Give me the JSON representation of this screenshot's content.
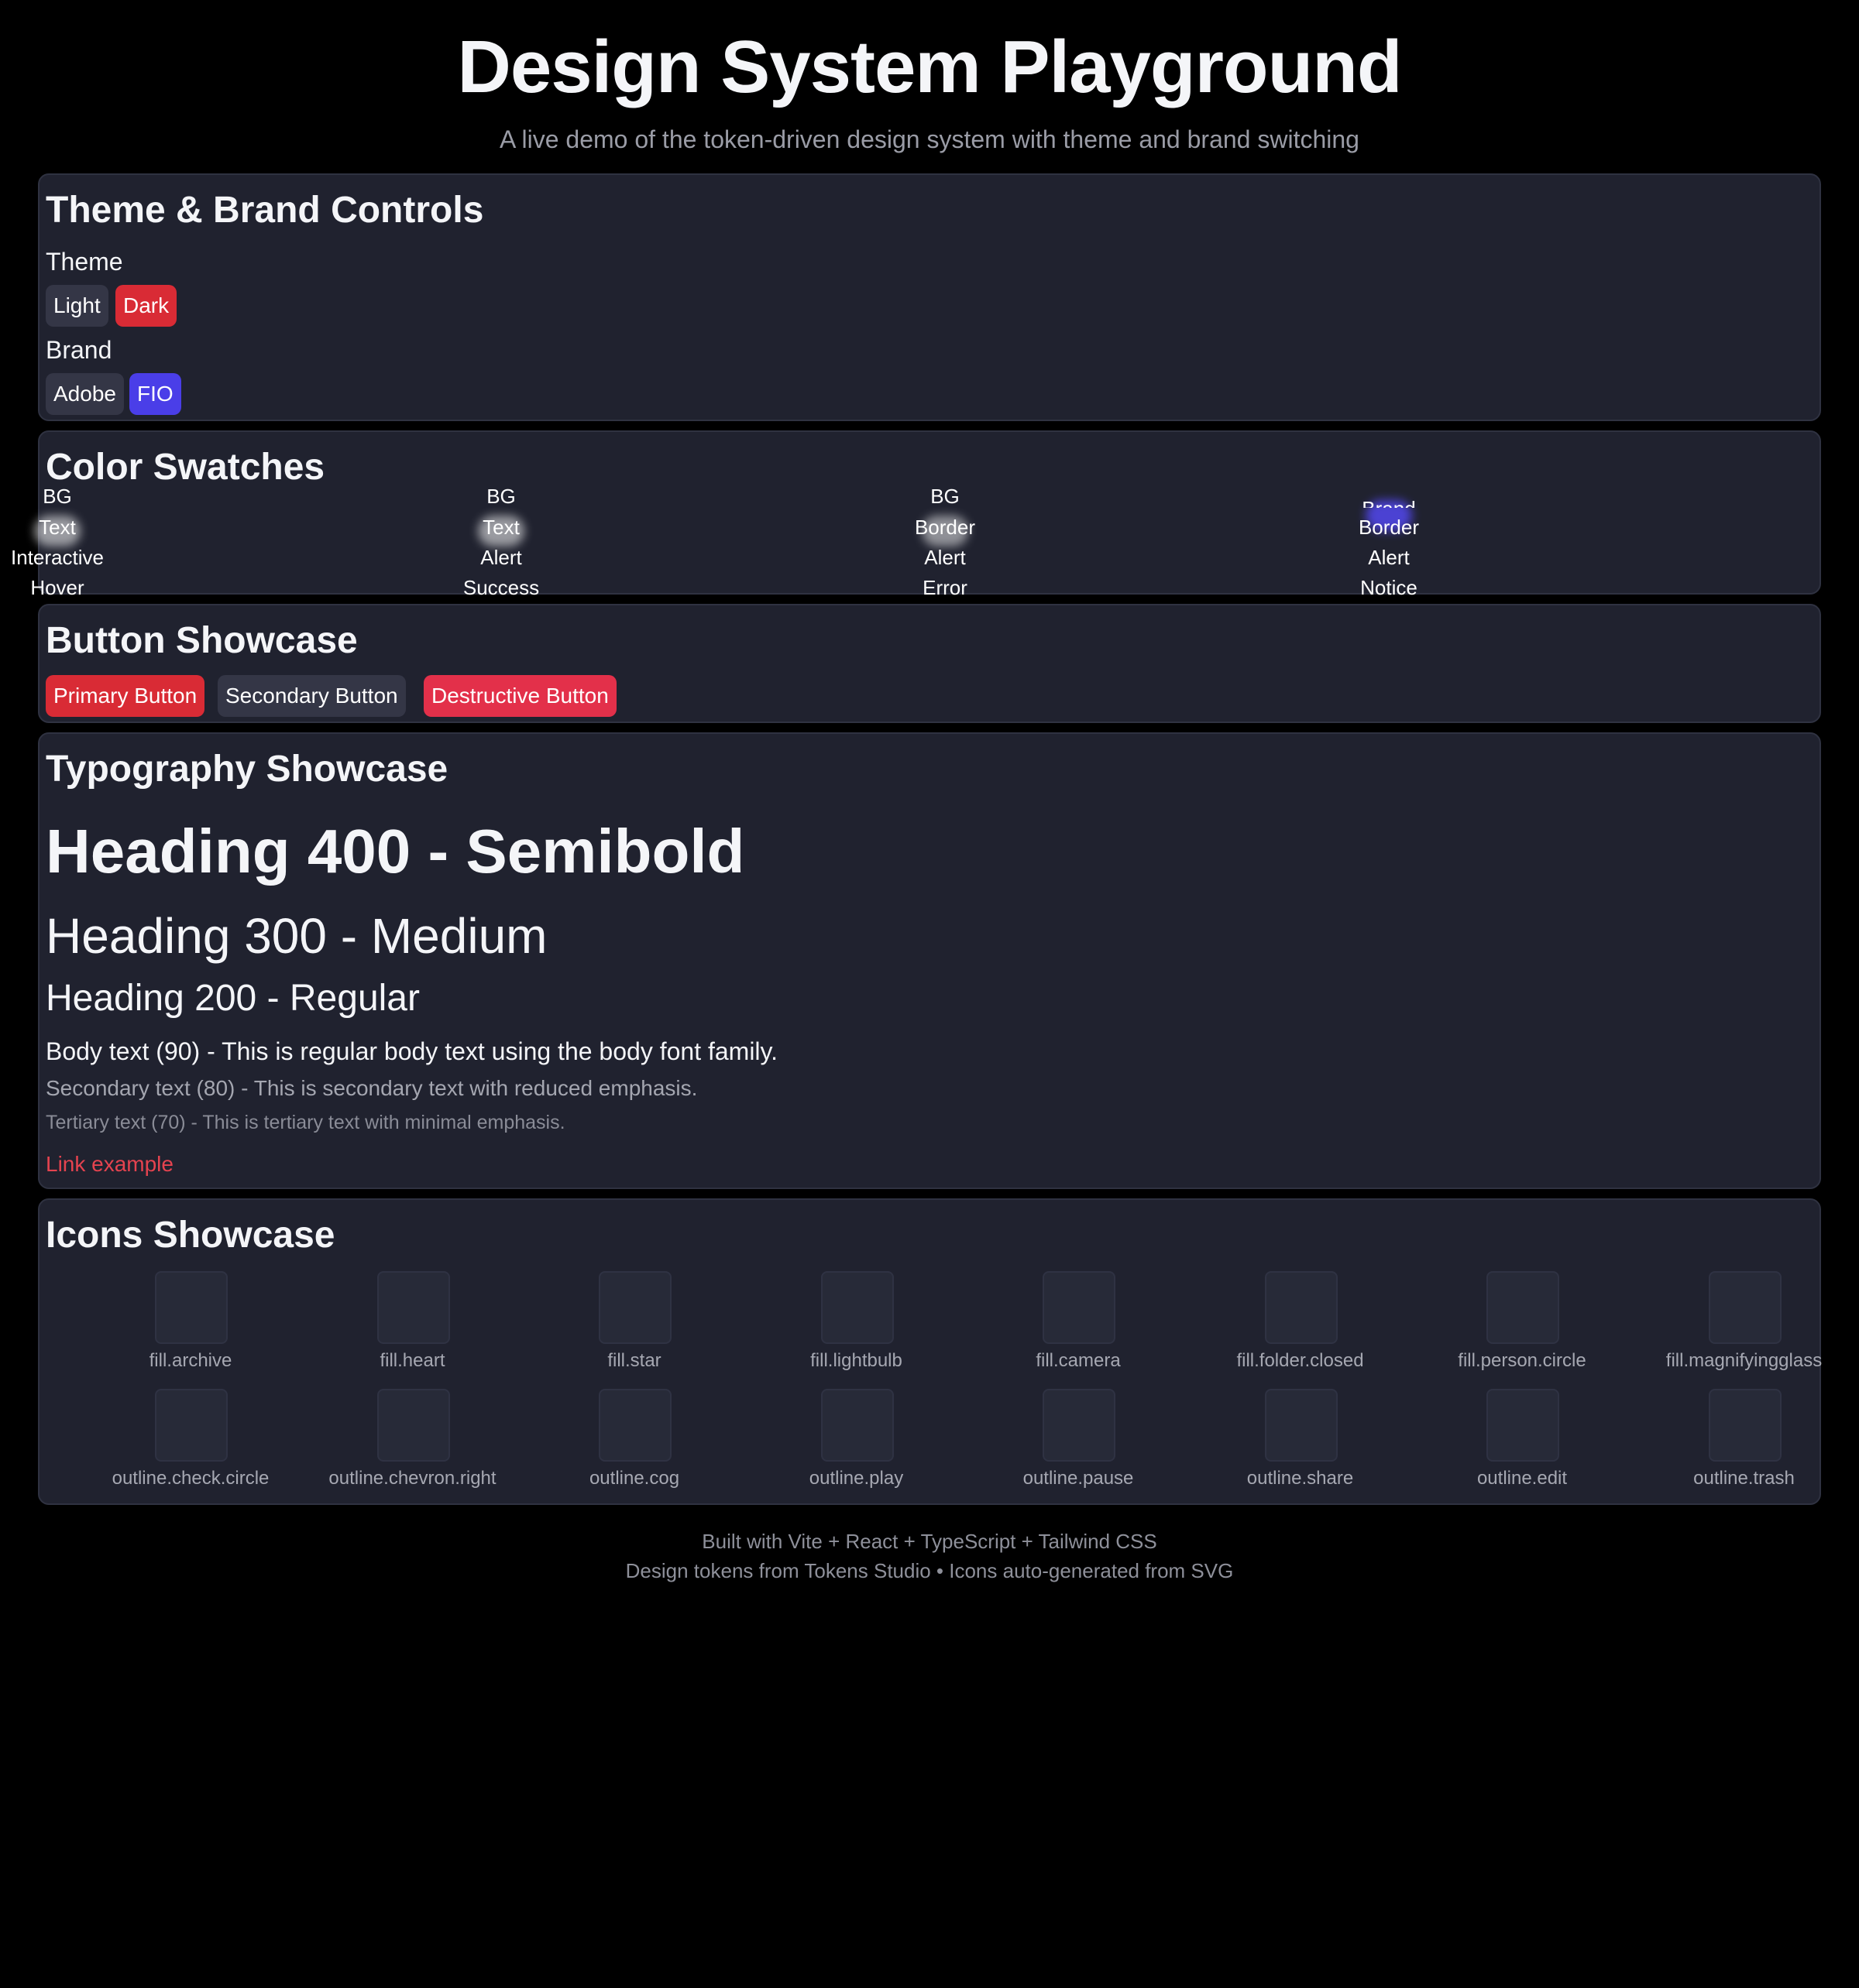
{
  "header": {
    "title": "Design System Playground",
    "subtitle": "A live demo of the token-driven design system with theme and brand switching"
  },
  "controls": {
    "title": "Theme & Brand Controls",
    "theme_label": "Theme",
    "theme_options": [
      "Light",
      "Dark"
    ],
    "theme_selected": "Dark",
    "brand_label": "Brand",
    "brand_options": [
      "Adobe",
      "FIO"
    ],
    "brand_selected": "FIO"
  },
  "swatches": {
    "title": "Color Swatches",
    "columns": [
      {
        "lines": [
          "BG",
          "Text",
          "Interactive",
          "Hover"
        ],
        "chip_color": "#ffffff"
      },
      {
        "lines": [
          "BG",
          "Text",
          "Alert",
          "Success"
        ],
        "chip_color": "#ffffff"
      },
      {
        "lines": [
          "BG",
          "Border",
          "Alert",
          "Error"
        ],
        "chip_color": "#ffffff"
      },
      {
        "lines": [
          "Brand",
          "Border",
          "Alert",
          "Notice"
        ],
        "chip_color": "#5046e5"
      }
    ]
  },
  "buttons": {
    "title": "Button Showcase",
    "primary": "Primary Button",
    "secondary": "Secondary Button",
    "destructive": "Destructive Button"
  },
  "typography": {
    "title": "Typography Showcase",
    "h400": "Heading 400 - Semibold",
    "h300": "Heading 300 - Medium",
    "h200": "Heading 200 - Regular",
    "body": "Body text (90) - This is regular body text using the body font family.",
    "secondary": "Secondary text (80) - This is secondary text with reduced emphasis.",
    "tertiary": "Tertiary text (70) - This is tertiary text with minimal emphasis.",
    "link": "Link example"
  },
  "icons": {
    "title": "Icons Showcase",
    "items": [
      "fill.archive",
      "fill.heart",
      "fill.star",
      "fill.lightbulb",
      "fill.camera",
      "fill.folder.closed",
      "fill.person.circle",
      "fill.magnifyingglass",
      "outline.check.circle",
      "outline.chevron.right",
      "outline.cog",
      "outline.play",
      "outline.pause",
      "outline.share",
      "outline.edit",
      "outline.trash"
    ]
  },
  "footer": {
    "line1": "Built with Vite + React + TypeScript + Tailwind CSS",
    "line2": "Design tokens from Tokens Studio • Icons auto-generated from SVG"
  },
  "colors": {
    "page_bg": "#000000",
    "panel_bg": "#20222f",
    "accent_red": "#d92b35",
    "brand_blue": "#4a3ee8",
    "destructive": "#e3304a",
    "link": "#e5434f"
  }
}
